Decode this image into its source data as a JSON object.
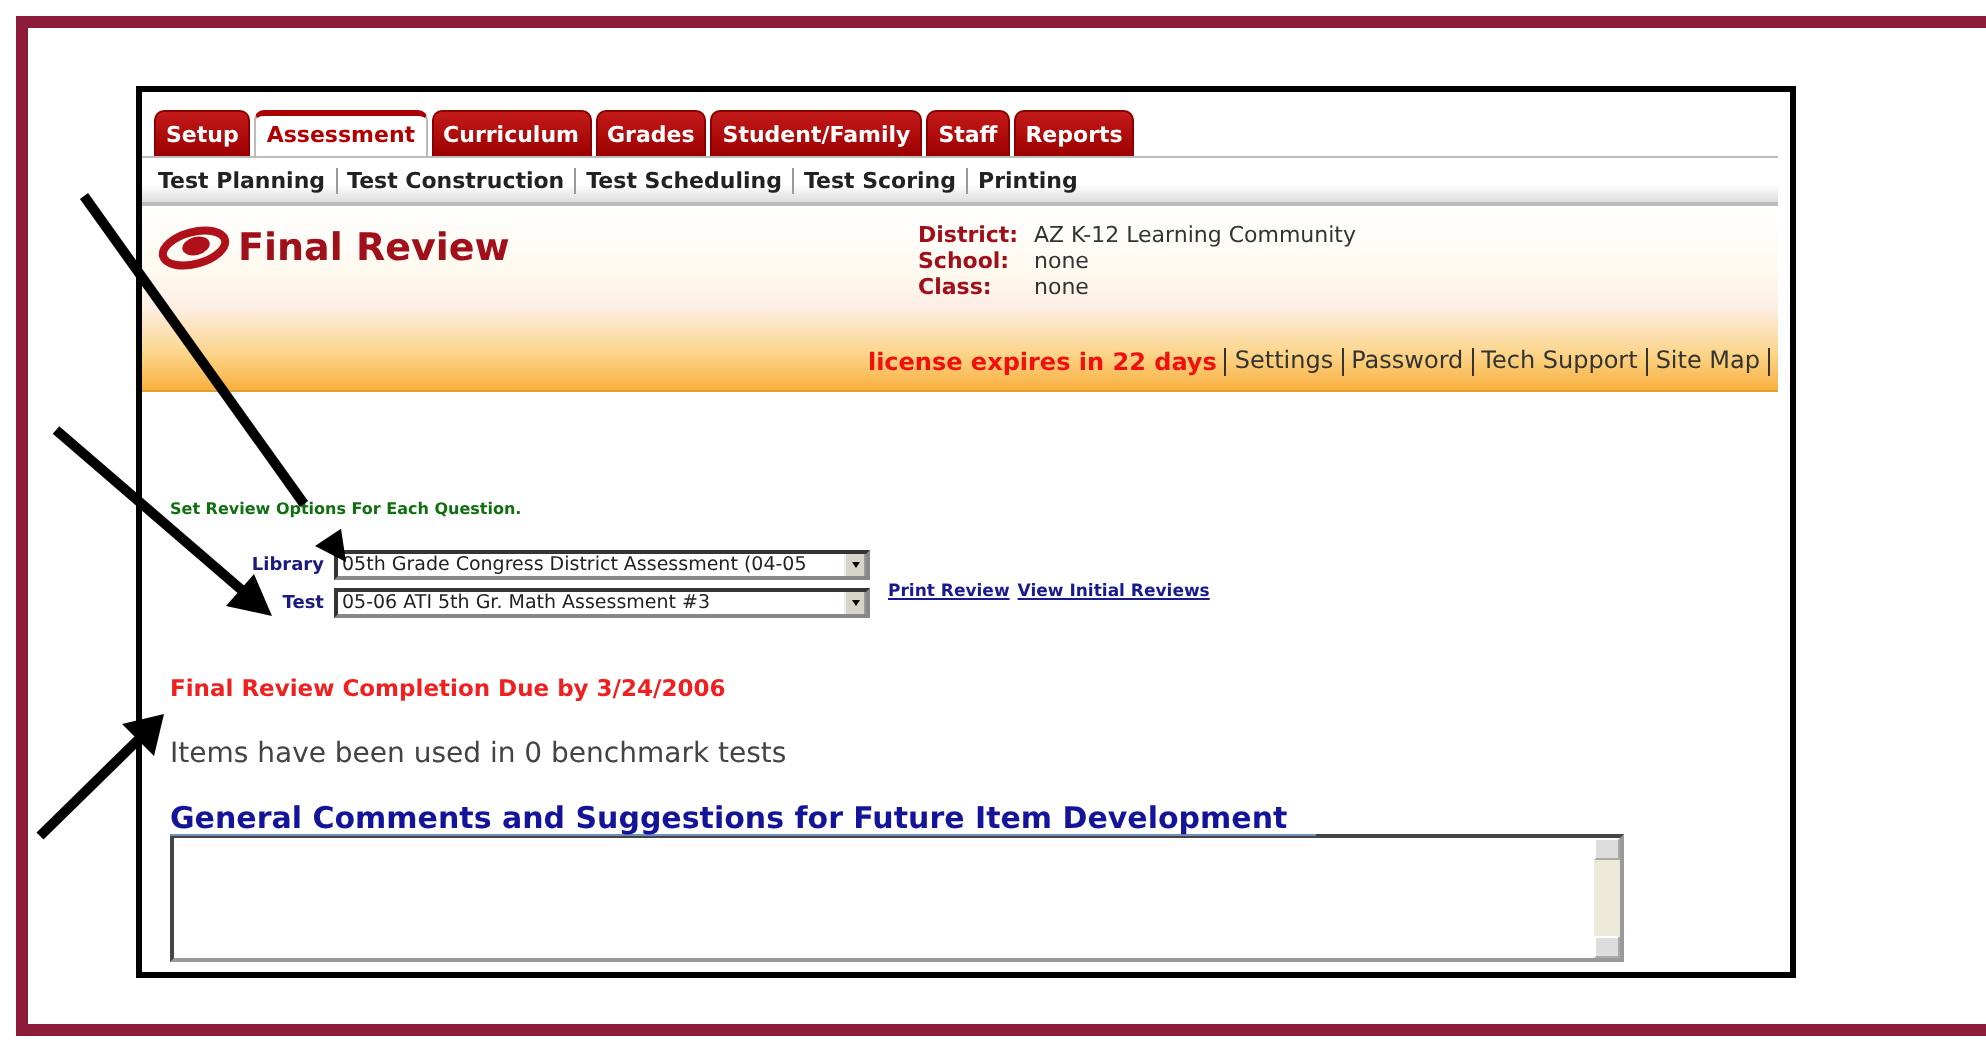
{
  "tabs": [
    {
      "label": "Setup",
      "selected": false
    },
    {
      "label": "Assessment",
      "selected": true
    },
    {
      "label": "Curriculum",
      "selected": false
    },
    {
      "label": "Grades",
      "selected": false
    },
    {
      "label": "Student/Family",
      "selected": false
    },
    {
      "label": "Staff",
      "selected": false
    },
    {
      "label": "Reports",
      "selected": false
    }
  ],
  "subnav": [
    "Test Planning",
    "Test Construction",
    "Test Scheduling",
    "Test Scoring",
    "Printing"
  ],
  "header": {
    "title": "Final Review",
    "info": [
      {
        "label": "District:",
        "value": "AZ K-12 Learning Community"
      },
      {
        "label": "School:",
        "value": "none"
      },
      {
        "label": "Class:",
        "value": "none"
      }
    ],
    "license": "license expires in 22 days",
    "links": [
      "Settings",
      "Password",
      "Tech Support",
      "Site Map"
    ]
  },
  "instructions": "Set Review Options For Each Question.",
  "selectors": [
    {
      "label": "Library",
      "value": "05th Grade Congress District Assessment (04-05"
    },
    {
      "label": "Test",
      "value": "05-06 ATI 5th Gr. Math Assessment #3"
    }
  ],
  "links": [
    "Print Review",
    "View Initial Reviews"
  ],
  "due": "Final Review Completion Due by 3/24/2006",
  "usage": "Items have been used in 0 benchmark tests",
  "comments": {
    "heading": "General Comments and Suggestions for Future Item Development"
  }
}
